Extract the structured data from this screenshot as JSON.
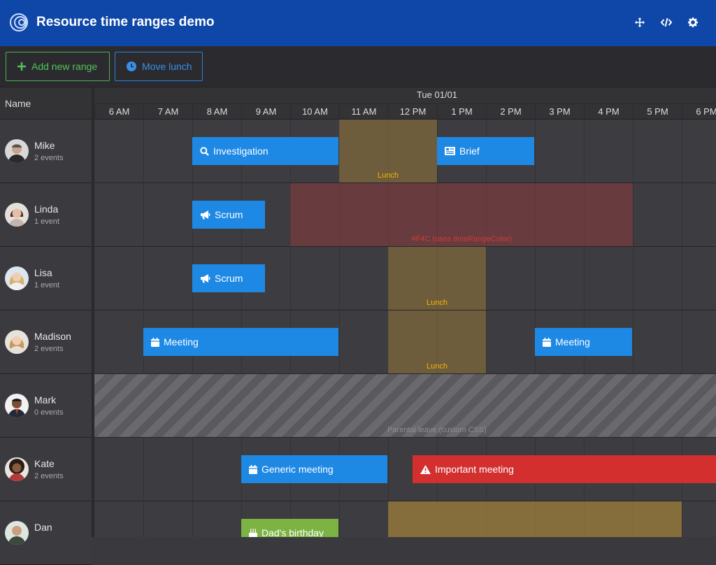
{
  "app": {
    "title": "Resource time ranges demo"
  },
  "toolbar": {
    "add_label": "Add new range",
    "move_label": "Move lunch"
  },
  "grid": {
    "name_header": "Name",
    "date": "Tue 01/01",
    "hours": [
      "6 AM",
      "7 AM",
      "8 AM",
      "9 AM",
      "10 AM",
      "11 AM",
      "12 PM",
      "1 PM",
      "2 PM",
      "3 PM",
      "4 PM",
      "5 PM",
      "6 PM"
    ]
  },
  "resources": [
    {
      "name": "Mike",
      "count": "2 events"
    },
    {
      "name": "Linda",
      "count": "1 event"
    },
    {
      "name": "Lisa",
      "count": "1 event"
    },
    {
      "name": "Madison",
      "count": "2 events"
    },
    {
      "name": "Mark",
      "count": "0 events"
    },
    {
      "name": "Kate",
      "count": "2 events"
    },
    {
      "name": "Dan",
      "count": ""
    }
  ],
  "ranges": {
    "r0": "Lunch",
    "r1": "#F4C (uses timeRangeColor)",
    "r2": "Lunch",
    "r3": "Lunch",
    "r4": "Parental leave (custom CSS)",
    "r5": ""
  },
  "events": {
    "e0": "Investigation",
    "e1": "Brief",
    "e2": "Scrum",
    "e3": "Scrum",
    "e4": "Meeting",
    "e5": "Meeting",
    "e6": "Generic meeting",
    "e7": "Important meeting",
    "e8": "Dad's birthday"
  },
  "colors": {
    "header": "#0f47a8",
    "event_blue": "#1e88e5",
    "event_red": "#d32f2f",
    "event_green": "#7cb342",
    "lunch": "#b38a3a",
    "custom_range": "#b03a3a"
  }
}
